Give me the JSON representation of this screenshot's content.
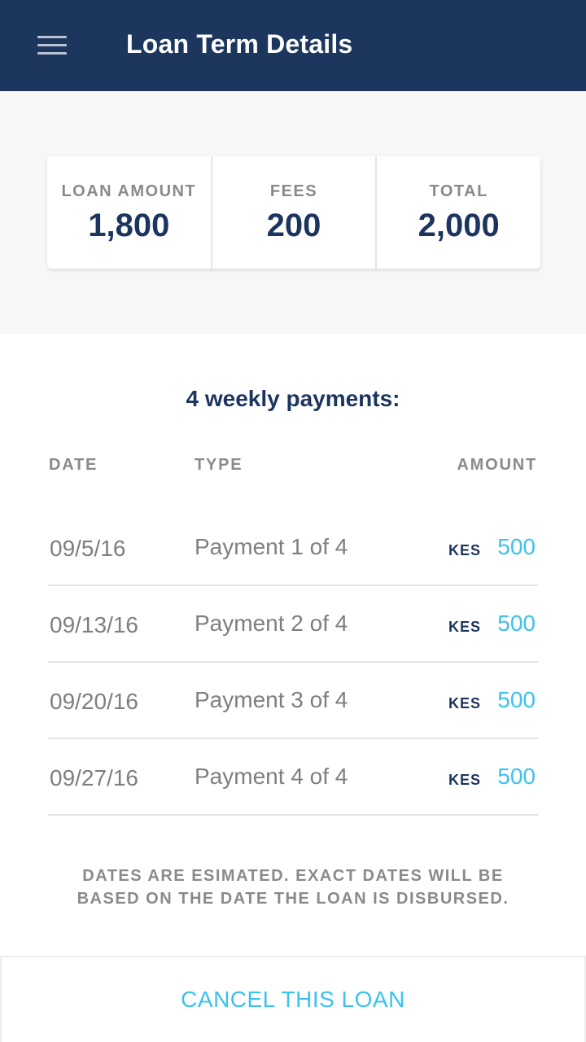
{
  "header": {
    "title": "Loan Term Details",
    "menu_icon": "hamburger-menu-icon"
  },
  "summary": {
    "loan_amount_label": "LOAN AMOUNT",
    "loan_amount_value": "1,800",
    "fees_label": "FEES",
    "fees_value": "200",
    "total_label": "TOTAL",
    "total_value": "2,000"
  },
  "payments": {
    "title": "4 weekly payments:",
    "columns": [
      "DATE",
      "TYPE",
      "AMOUNT"
    ],
    "rows": [
      {
        "date": "09/5/16",
        "type": "Payment 1 of 4",
        "currency": "KES",
        "amount": "500"
      },
      {
        "date": "09/13/16",
        "type": "Payment 2 of 4",
        "currency": "KES",
        "amount": "500"
      },
      {
        "date": "09/20/16",
        "type": "Payment 3 of 4",
        "currency": "KES",
        "amount": "500"
      },
      {
        "date": "09/27/16",
        "type": "Payment 4 of 4",
        "currency": "KES",
        "amount": "500"
      }
    ]
  },
  "disclaimer": {
    "line1": "DATES ARE ESIMATED. EXACT DATES WILL BE",
    "line2": "BASED ON THE DATE THE LOAN IS DISBURSED."
  },
  "footer": {
    "cancel_label": "CANCEL THIS LOAN"
  },
  "colors": {
    "header_bg": "#1c365e",
    "primary_text": "#1c355e",
    "accent": "#3bc2f0",
    "muted_text": "#8a8a8a"
  }
}
